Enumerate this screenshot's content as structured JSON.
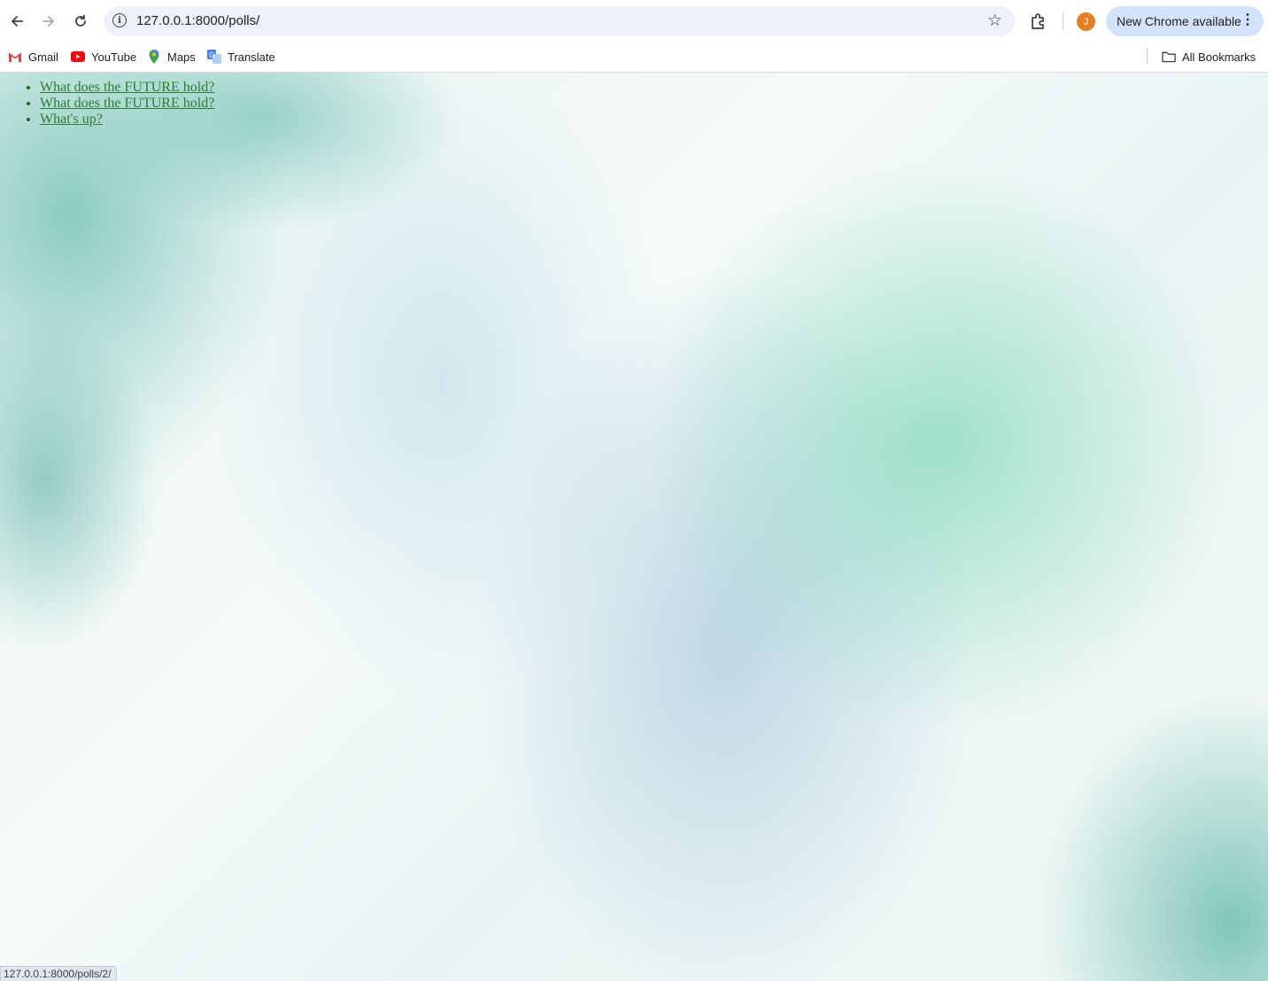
{
  "browser": {
    "url": "127.0.0.1:8000/polls/",
    "update_button_label": "New Chrome available",
    "avatar_initial": "J",
    "bookmarks": [
      {
        "label": "Gmail",
        "icon": "gmail-icon"
      },
      {
        "label": "YouTube",
        "icon": "youtube-icon"
      },
      {
        "label": "Maps",
        "icon": "maps-icon"
      },
      {
        "label": "Translate",
        "icon": "translate-icon"
      }
    ],
    "all_bookmarks_label": "All Bookmarks",
    "status_url": "127.0.0.1:8000/polls/2/"
  },
  "page": {
    "polls": [
      {
        "text": "What does the FUTURE hold?"
      },
      {
        "text": "What does the FUTURE hold?"
      },
      {
        "text": "What's up?"
      }
    ],
    "link_color": "#2e7d32"
  }
}
